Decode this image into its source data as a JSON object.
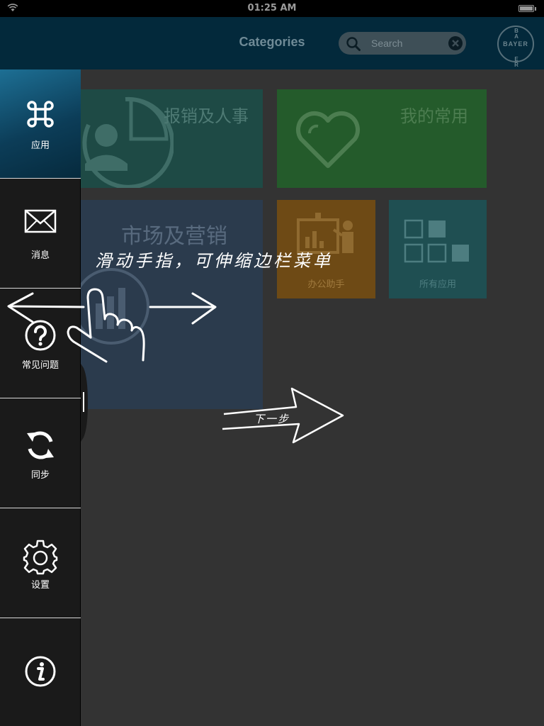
{
  "status_bar": {
    "time": "01:25 AM"
  },
  "header": {
    "title": "Categories",
    "search": {
      "placeholder": "Search",
      "value": ""
    },
    "logo_text": "BAYER"
  },
  "sidebar": {
    "items": [
      {
        "id": "apps",
        "label": "应用",
        "icon": "command-icon",
        "active": true
      },
      {
        "id": "messages",
        "label": "消息",
        "icon": "envelope-icon",
        "active": false
      },
      {
        "id": "faq",
        "label": "常见问题",
        "icon": "question-circle-icon",
        "active": false
      },
      {
        "id": "sync",
        "label": "同步",
        "icon": "sync-icon",
        "active": false
      },
      {
        "id": "settings",
        "label": "设置",
        "icon": "gear-icon",
        "active": false
      },
      {
        "id": "info",
        "label": "",
        "icon": "info-icon",
        "active": false
      }
    ]
  },
  "tiles": {
    "reimbursement": {
      "label": "报销及人事",
      "color": "#1e4a45"
    },
    "favorites": {
      "label": "我的常用",
      "color": "#245b2b"
    },
    "marketing": {
      "label": "市场及营销",
      "color": "#2b3b4d"
    },
    "office_assistant": {
      "label": "办公助手",
      "color": "#6e4a15"
    },
    "all_apps": {
      "label": "所有应用",
      "color": "#1f4f52"
    }
  },
  "tutorial": {
    "hint": "滑动手指，可伸缩边栏菜单",
    "next_label": "下一步"
  },
  "colors": {
    "header_bg": "#03293b",
    "sidebar_bg": "#1a1a1a",
    "main_bg": "#333333",
    "active_item": "#1d6f94"
  }
}
